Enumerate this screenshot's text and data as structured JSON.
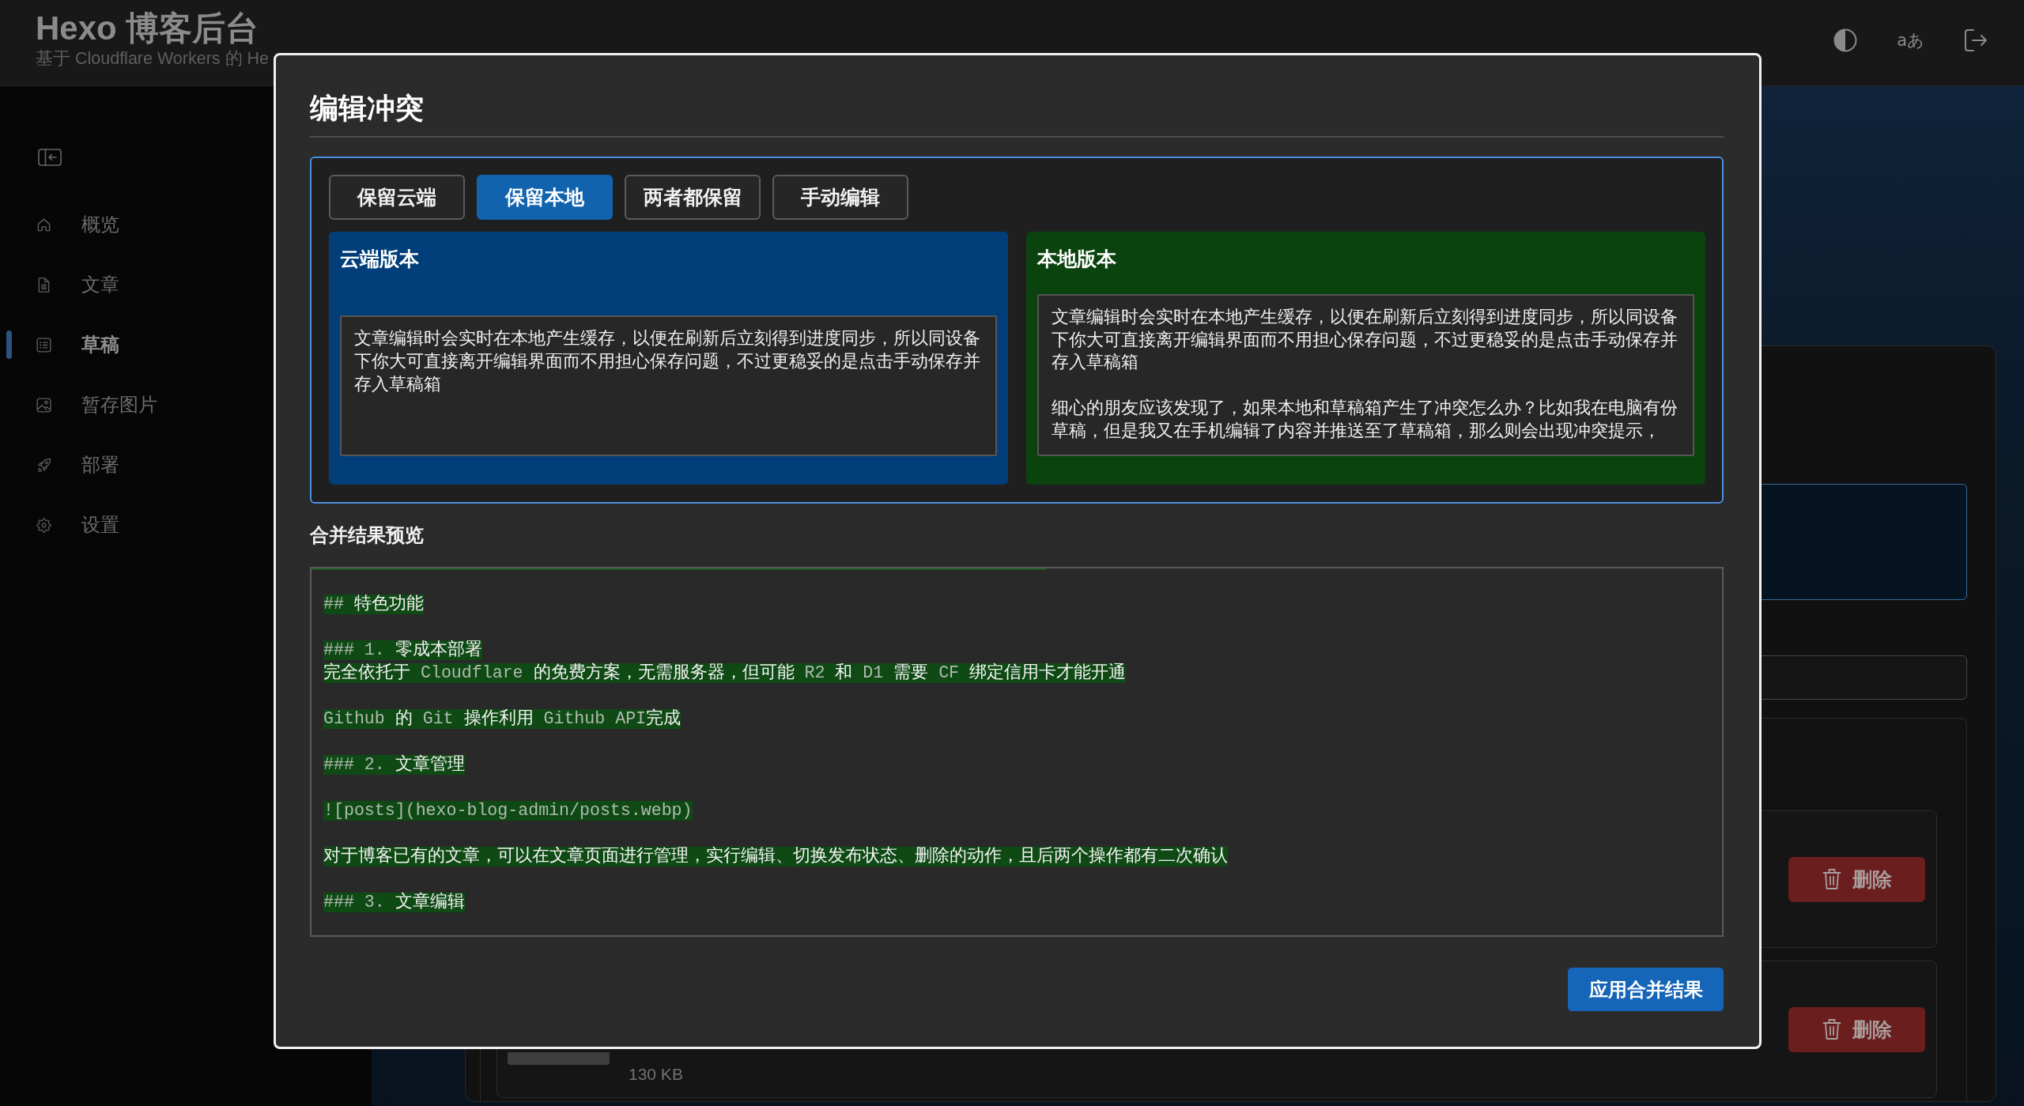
{
  "header": {
    "title": "Hexo 博客后台",
    "subtitle": "基于 Cloudflare Workers 的 He",
    "actions": [
      {
        "kind": "theme"
      },
      {
        "kind": "language",
        "glyph": "aあ"
      },
      {
        "kind": "logout"
      }
    ]
  },
  "sidebar": {
    "items": [
      {
        "kind": "overview",
        "label": "概览",
        "selected": false
      },
      {
        "kind": "posts",
        "label": "文章",
        "selected": false
      },
      {
        "kind": "drafts",
        "label": "草稿",
        "selected": true
      },
      {
        "kind": "images",
        "label": "暂存图片",
        "selected": false
      },
      {
        "kind": "deploy",
        "label": "部署",
        "selected": false
      },
      {
        "kind": "settings",
        "label": "设置",
        "selected": false
      }
    ]
  },
  "files": [
    {
      "delete_label": "删除"
    },
    {
      "size": "130 KB",
      "delete_label": "删除"
    }
  ],
  "conflict_dialog": {
    "title": "编辑冲突",
    "tabs": [
      {
        "label": "保留云端",
        "selected": false
      },
      {
        "label": "保留本地",
        "selected": true
      },
      {
        "label": "两者都保留",
        "selected": false
      },
      {
        "label": "手动编辑",
        "selected": false
      }
    ],
    "versions": [
      {
        "kind": "cloud",
        "title": "云端版本",
        "paragraphs": [
          "文章编辑时会实时在本地产生缓存，以便在刷新后立刻得到进度同步，所以同设备下你大可直接离开编辑界面而不用担心保存问题，不过更稳妥的是点击手动保存并存入草稿箱"
        ]
      },
      {
        "kind": "local",
        "title": "本地版本",
        "paragraphs": [
          "文章编辑时会实时在本地产生缓存，以便在刷新后立刻得到进度同步，所以同设备下你大可直接离开编辑界面而不用担心保存问题，不过更稳妥的是点击手动保存并存入草稿箱",
          "细心的朋友应该发现了，如果本地和草稿箱产生了冲突怎么办？比如我在电脑有份草稿，但是我又在手机编辑了内容并推送至了草稿箱，那么则会出现冲突提示，"
        ]
      }
    ],
    "preview": {
      "title": "合并结果预览",
      "blocks": [
        {
          "lines": [
            {
              "text": "## 特色功能",
              "added": true
            }
          ]
        },
        {
          "lines": [
            {
              "text": "### 1. 零成本部署",
              "added": true
            },
            {
              "text": "完全依托于 Cloudflare 的免费方案，无需服务器，但可能 R2 和 D1 需要 CF 绑定信用卡才能开通",
              "added": true
            }
          ]
        },
        {
          "lines": [
            {
              "text": "Github 的 Git 操作利用 Github API完成",
              "added": true
            }
          ]
        },
        {
          "lines": [
            {
              "text": "### 2. 文章管理",
              "added": true
            }
          ]
        },
        {
          "lines": [
            {
              "text": "![posts](hexo-blog-admin/posts.webp)",
              "added": true
            }
          ]
        },
        {
          "lines": [
            {
              "text": "对于博客已有的文章，可以在文章页面进行管理，实行编辑、切换发布状态、删除的动作，且后两个操作都有二次确认",
              "added": true
            }
          ]
        },
        {
          "lines": [
            {
              "text": "### 3. 文章编辑",
              "added": true
            }
          ]
        }
      ]
    },
    "apply_button": "应用合并结果"
  }
}
